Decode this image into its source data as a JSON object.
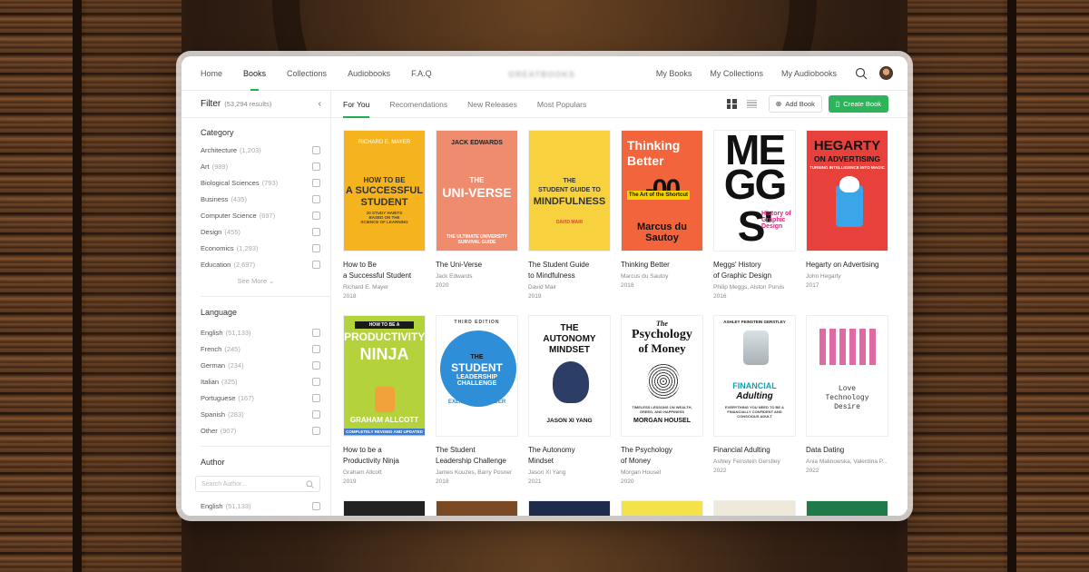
{
  "nav": {
    "items": [
      "Home",
      "Books",
      "Collections",
      "Audiobooks",
      "F.A.Q"
    ],
    "active": "Books",
    "logo": "GREATBOOKS",
    "right_items": [
      "My Books",
      "My Collections",
      "My Audiobooks"
    ]
  },
  "filter": {
    "title": "Filter",
    "count": "(53,294 results)",
    "collapse_icon": "chevron-left-icon",
    "category": {
      "title": "Category",
      "options": [
        {
          "label": "Architecture",
          "count": "(1,203)"
        },
        {
          "label": "Art",
          "count": "(989)"
        },
        {
          "label": "Biological Sciences",
          "count": "(793)"
        },
        {
          "label": "Business",
          "count": "(435)"
        },
        {
          "label": "Computer Science",
          "count": "(697)"
        },
        {
          "label": "Design",
          "count": "(455)"
        },
        {
          "label": "Economics",
          "count": "(1,293)"
        },
        {
          "label": "Education",
          "count": "(2,697)"
        }
      ],
      "see_more": "See More"
    },
    "language": {
      "title": "Language",
      "options": [
        {
          "label": "English",
          "count": "(51,133)"
        },
        {
          "label": "French",
          "count": "(245)"
        },
        {
          "label": "German",
          "count": "(234)"
        },
        {
          "label": "Italian",
          "count": "(325)"
        },
        {
          "label": "Portuguese",
          "count": "(167)"
        },
        {
          "label": "Spanish",
          "count": "(283)"
        },
        {
          "label": "Other",
          "count": "(907)"
        }
      ]
    },
    "author": {
      "title": "Author",
      "placeholder": "Search Author...",
      "options": [
        {
          "label": "English",
          "count": "(51,133)"
        }
      ]
    }
  },
  "tabs": [
    "For You",
    "Recomendations",
    "New Releases",
    "Most Populars"
  ],
  "active_tab": "For You",
  "toolbar": {
    "add_label": "Add Book",
    "create_label": "Create Book"
  },
  "colors": {
    "accent": "#2db35a"
  },
  "books": [
    {
      "title1": "How to Be",
      "title2": "a Successful Student",
      "author": "Richard E. Mayer",
      "year": "2018",
      "cover": {
        "bg": "#f5b41e",
        "author": "RICHARD E. MAYER",
        "l1": "HOW TO BE",
        "l2": "A SUCCESSFUL",
        "l3": "STUDENT",
        "sub": "20 STUDY HABITS BASED ON THE SCIENCE OF LEARNING"
      }
    },
    {
      "title1": "The Uni-Verse",
      "title2": "",
      "author": "Jack Edwards",
      "year": "2020",
      "cover": {
        "bg": "#f08c6e",
        "author": "JACK EDWARDS",
        "l1": "THE",
        "l2": "UNI-VERSE",
        "l3": "",
        "sub": "THE ULTIMATE UNIVERSITY SURVIVAL GUIDE"
      }
    },
    {
      "title1": "The Student Guide",
      "title2": "to Mindfulness",
      "author": "David Mair",
      "year": "2019",
      "cover": {
        "bg": "#f7d23e",
        "author": "DAVID MAIR",
        "l1": "THE",
        "l2": "STUDENT GUIDE TO",
        "l3": "MINDFULNESS",
        "sub": ""
      }
    },
    {
      "title1": "Thinking Better",
      "title2": "",
      "author": "Marcus du Sautoy",
      "year": "2018",
      "cover": {
        "bg": "#f2643c",
        "author": "Marcus du Sautoy",
        "l1": "Thinking",
        "l2": "Better",
        "l3": "The Art of the Shortcut",
        "sub": ""
      }
    },
    {
      "title1": "Meggs' History",
      "title2": "of Graphic Design",
      "author": "Philip Meggs, Alston Purvis",
      "year": "2016",
      "cover": {
        "bg": "#ffffff",
        "author": "",
        "l1": "ME",
        "l2": "GG",
        "l3": "S'",
        "sub": "History of Graphic Design"
      }
    },
    {
      "title1": "Hegarty on Advertising",
      "title2": "",
      "author": "John Hegarty",
      "year": "2017",
      "cover": {
        "bg": "#e8403a",
        "author": "",
        "l1": "HEGARTY",
        "l2": "ON ADVERTISING",
        "l3": "",
        "sub": "TURNING INTELLIGENCE INTO MAGIC"
      }
    },
    {
      "title1": "How to be a",
      "title2": "Productivity Ninja",
      "author": "Graham Allcott",
      "year": "2019",
      "cover": {
        "bg": "#b4d23c",
        "author": "GRAHAM ALLCOTT",
        "l1": "HOW TO BE A",
        "l2": "PRODUCTIVITY",
        "l3": "NINJA",
        "sub": "COMPLETELY REVISED AND UPDATED"
      }
    },
    {
      "title1": "The Student",
      "title2": "Leadership Challenge",
      "author": "James Kouzes, Barry Posner",
      "year": "2018",
      "cover": {
        "bg": "#ffffff",
        "author": "THIRD EDITION",
        "l1": "THE",
        "l2": "STUDENT",
        "l3": "LEADERSHIP CHALLENGE",
        "sub": "EXEMPLARY LEADER"
      }
    },
    {
      "title1": "The Autonomy",
      "title2": "Mindset",
      "author": "Jason Xi Yang",
      "year": "2021",
      "cover": {
        "bg": "#ffffff",
        "author": "JASON XI YANG",
        "l1": "THE",
        "l2": "AUTONOMY",
        "l3": "MINDSET",
        "sub": ""
      }
    },
    {
      "title1": "The Psychology",
      "title2": "of Money",
      "author": "Morgan Housel",
      "year": "2020",
      "cover": {
        "bg": "#ffffff",
        "author": "MORGAN HOUSEL",
        "l1": "The",
        "l2": "Psychology",
        "l3": "of Money",
        "sub": "TIMELESS LESSONS ON WEALTH, GREED, AND HAPPINESS"
      }
    },
    {
      "title1": "Financial Adulting",
      "title2": "",
      "author": "Ashley Feinstein Gerstley",
      "year": "2022",
      "cover": {
        "bg": "#ffffff",
        "author": "ASHLEY FEINSTEIN GERSTLEY",
        "l1": "FINANCIAL",
        "l2": "Adulting",
        "l3": "",
        "sub": "EVERYTHING YOU NEED TO BE A FINANCIALLY CONFIDENT AND CONSCIOUS ADULT"
      }
    },
    {
      "title1": "Data Dating",
      "title2": "",
      "author": "Ania Malinowska, Valentina P...",
      "year": "2022",
      "cover": {
        "bg": "#ffffff",
        "author": "",
        "l1": "Love",
        "l2": "Technology",
        "l3": "Desire",
        "sub": ""
      }
    }
  ]
}
